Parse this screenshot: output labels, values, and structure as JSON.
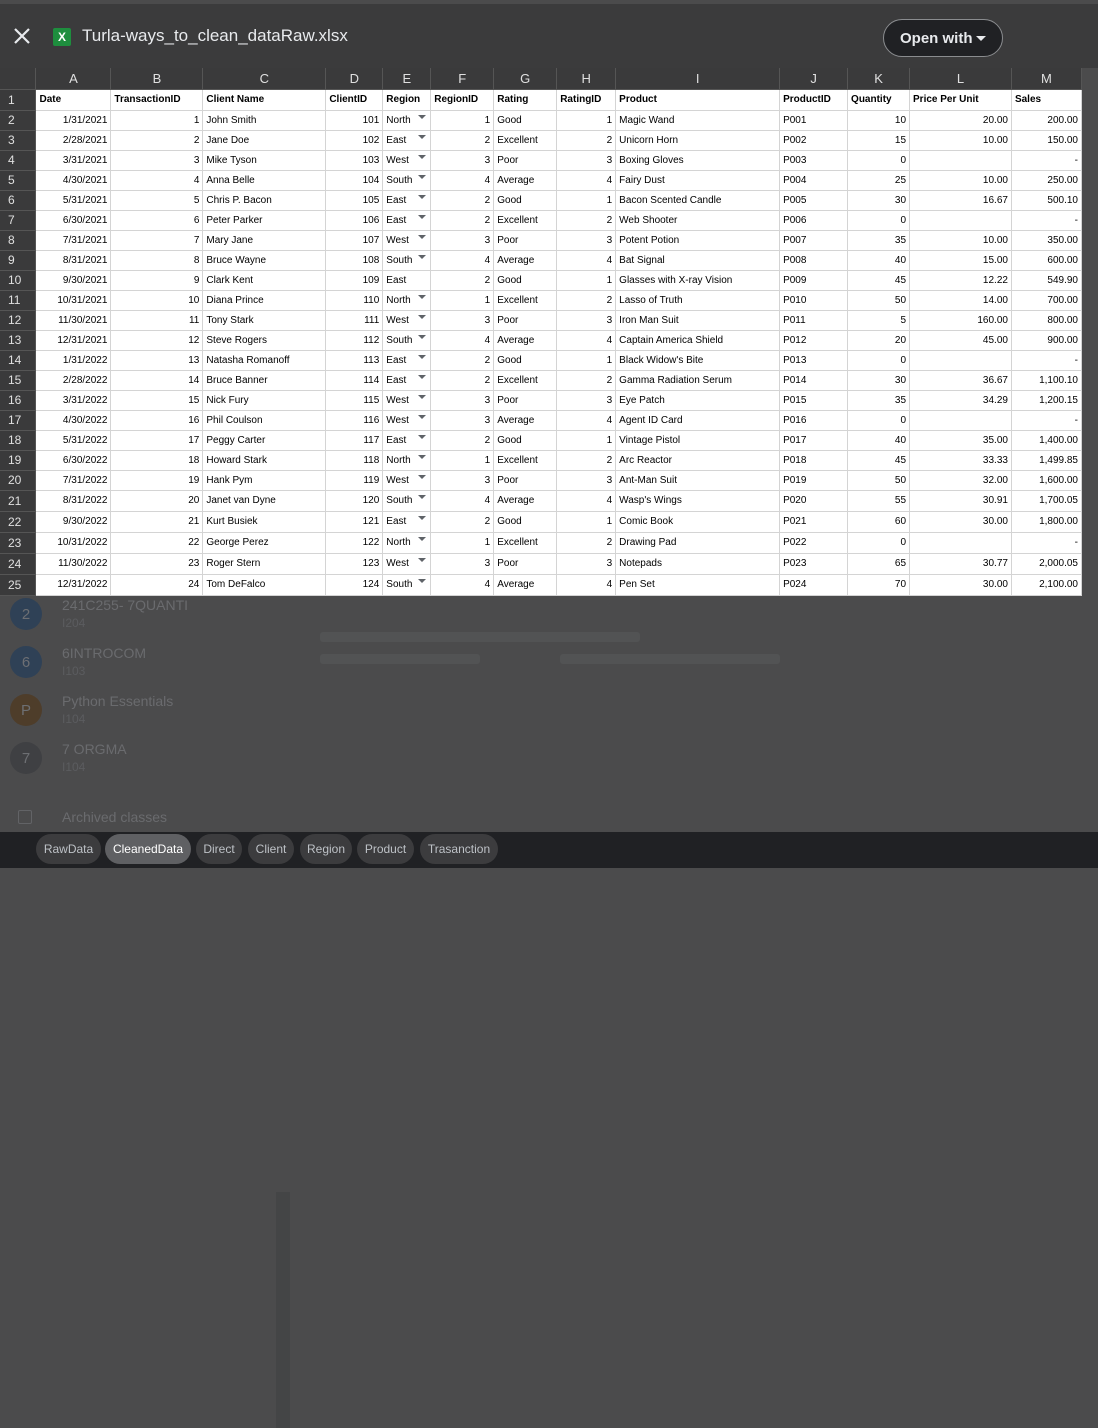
{
  "header": {
    "title": "Turla-ways_to_clean_dataRaw.xlsx",
    "file_icon_letter": "X",
    "open_with_label": "Open with"
  },
  "columns": [
    "A",
    "B",
    "C",
    "D",
    "E",
    "F",
    "G",
    "H",
    "I",
    "J",
    "K",
    "L",
    "M"
  ],
  "header_row": [
    "Date",
    "TransactionID",
    "Client Name",
    "ClientID",
    "Region",
    "RegionID",
    "Rating",
    "RatingID",
    "Product",
    "ProductID",
    "Quantity",
    "Price Per Unit",
    "Sales"
  ],
  "rows": [
    [
      "1/31/2021",
      "1",
      "John Smith",
      "101",
      "North",
      "1",
      "Good",
      "1",
      "Magic Wand",
      "P001",
      "10",
      "20.00",
      "200.00"
    ],
    [
      "2/28/2021",
      "2",
      "Jane Doe",
      "102",
      "East",
      "2",
      "Excellent",
      "2",
      "Unicorn Horn",
      "P002",
      "15",
      "10.00",
      "150.00"
    ],
    [
      "3/31/2021",
      "3",
      "Mike Tyson",
      "103",
      "West",
      "3",
      "Poor",
      "3",
      "Boxing Gloves",
      "P003",
      "0",
      "",
      "-"
    ],
    [
      "4/30/2021",
      "4",
      "Anna Belle",
      "104",
      "South",
      "4",
      "Average",
      "4",
      "Fairy Dust",
      "P004",
      "25",
      "10.00",
      "250.00"
    ],
    [
      "5/31/2021",
      "5",
      "Chris P. Bacon",
      "105",
      "East",
      "2",
      "Good",
      "1",
      "Bacon Scented Candle",
      "P005",
      "30",
      "16.67",
      "500.10"
    ],
    [
      "6/30/2021",
      "6",
      "Peter Parker",
      "106",
      "East",
      "2",
      "Excellent",
      "2",
      "Web Shooter",
      "P006",
      "0",
      "",
      "-"
    ],
    [
      "7/31/2021",
      "7",
      "Mary Jane",
      "107",
      "West",
      "3",
      "Poor",
      "3",
      "Potent Potion",
      "P007",
      "35",
      "10.00",
      "350.00"
    ],
    [
      "8/31/2021",
      "8",
      "Bruce Wayne",
      "108",
      "South",
      "4",
      "Average",
      "4",
      "Bat Signal",
      "P008",
      "40",
      "15.00",
      "600.00"
    ],
    [
      "9/30/2021",
      "9",
      "Clark Kent",
      "109",
      "East",
      "2",
      "Good",
      "1",
      "Glasses with X-ray Vision",
      "P009",
      "45",
      "12.22",
      "549.90"
    ],
    [
      "10/31/2021",
      "10",
      "Diana Prince",
      "110",
      "North",
      "1",
      "Excellent",
      "2",
      "Lasso of Truth",
      "P010",
      "50",
      "14.00",
      "700.00"
    ],
    [
      "11/30/2021",
      "11",
      "Tony Stark",
      "111",
      "West",
      "3",
      "Poor",
      "3",
      "Iron Man Suit",
      "P011",
      "5",
      "160.00",
      "800.00"
    ],
    [
      "12/31/2021",
      "12",
      "Steve Rogers",
      "112",
      "South",
      "4",
      "Average",
      "4",
      "Captain America Shield",
      "P012",
      "20",
      "45.00",
      "900.00"
    ],
    [
      "1/31/2022",
      "13",
      "Natasha Romanoff",
      "113",
      "East",
      "2",
      "Good",
      "1",
      "Black Widow's Bite",
      "P013",
      "0",
      "",
      "-"
    ],
    [
      "2/28/2022",
      "14",
      "Bruce Banner",
      "114",
      "East",
      "2",
      "Excellent",
      "2",
      "Gamma Radiation Serum",
      "P014",
      "30",
      "36.67",
      "1,100.10"
    ],
    [
      "3/31/2022",
      "15",
      "Nick Fury",
      "115",
      "West",
      "3",
      "Poor",
      "3",
      "Eye Patch",
      "P015",
      "35",
      "34.29",
      "1,200.15"
    ],
    [
      "4/30/2022",
      "16",
      "Phil Coulson",
      "116",
      "West",
      "3",
      "Average",
      "4",
      "Agent ID Card",
      "P016",
      "0",
      "",
      "-"
    ],
    [
      "5/31/2022",
      "17",
      "Peggy Carter",
      "117",
      "East",
      "2",
      "Good",
      "1",
      "Vintage Pistol",
      "P017",
      "40",
      "35.00",
      "1,400.00"
    ],
    [
      "6/30/2022",
      "18",
      "Howard Stark",
      "118",
      "North",
      "1",
      "Excellent",
      "2",
      "Arc Reactor",
      "P018",
      "45",
      "33.33",
      "1,499.85"
    ],
    [
      "7/31/2022",
      "19",
      "Hank Pym",
      "119",
      "West",
      "3",
      "Poor",
      "3",
      "Ant-Man Suit",
      "P019",
      "50",
      "32.00",
      "1,600.00"
    ],
    [
      "8/31/2022",
      "20",
      "Janet van Dyne",
      "120",
      "South",
      "4",
      "Average",
      "4",
      "Wasp's Wings",
      "P020",
      "55",
      "30.91",
      "1,700.05"
    ],
    [
      "9/30/2022",
      "21",
      "Kurt Busiek",
      "121",
      "East",
      "2",
      "Good",
      "1",
      "Comic Book",
      "P021",
      "60",
      "30.00",
      "1,800.00"
    ],
    [
      "10/31/2022",
      "22",
      "George Perez",
      "122",
      "North",
      "1",
      "Excellent",
      "2",
      "Drawing Pad",
      "P022",
      "0",
      "",
      "-"
    ],
    [
      "11/30/2022",
      "23",
      "Roger Stern",
      "123",
      "West",
      "3",
      "Poor",
      "3",
      "Notepads",
      "P023",
      "65",
      "30.77",
      "2,000.05"
    ],
    [
      "12/31/2022",
      "24",
      "Tom DeFalco",
      "124",
      "South",
      "4",
      "Average",
      "4",
      "Pen Set",
      "P024",
      "70",
      "30.00",
      "2,100.00"
    ]
  ],
  "region_dropdown_rows": [
    true,
    true,
    true,
    true,
    true,
    true,
    true,
    true,
    false,
    true,
    true,
    true,
    true,
    true,
    true,
    true,
    true,
    true,
    true,
    true,
    true,
    true,
    true,
    true
  ],
  "background_classes": [
    {
      "avatar": "2",
      "title": "241C255- 7QUANTI",
      "sub": "I204",
      "color": "#2f4156"
    },
    {
      "avatar": "6",
      "title": "6INTROCOM",
      "sub": "I103",
      "color": "#2f4156"
    },
    {
      "avatar": "P",
      "title": "Python Essentials",
      "sub": "I104",
      "color": "#4e3d2a"
    },
    {
      "avatar": "7",
      "title": "7 ORGMA",
      "sub": "I104",
      "color": "#3f4043"
    }
  ],
  "archived_label": "Archived classes",
  "tabs": [
    {
      "label": "RawData",
      "active": false
    },
    {
      "label": "CleanedData",
      "active": true
    },
    {
      "label": "Direct",
      "active": false
    },
    {
      "label": "Client",
      "active": false
    },
    {
      "label": "Region",
      "active": false
    },
    {
      "label": "Product",
      "active": false
    },
    {
      "label": "Trasanction",
      "active": false
    }
  ]
}
